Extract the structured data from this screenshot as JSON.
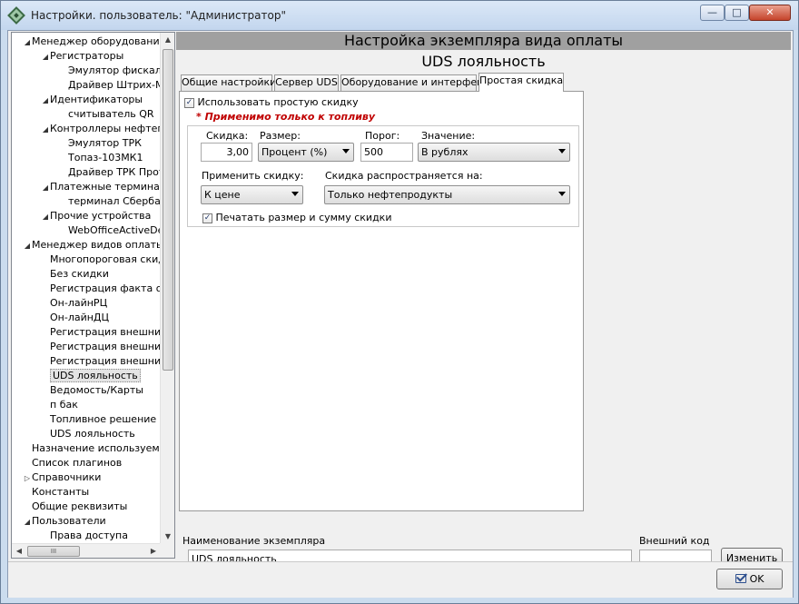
{
  "window": {
    "title": "Настройки. пользователь: \"Администратор\"",
    "min_icon": "minimize-icon",
    "max_icon": "maximize-icon",
    "close_icon": "close-icon"
  },
  "tree": {
    "items": [
      {
        "label": "Менеджер оборудования",
        "level": 0,
        "expander": "expanded"
      },
      {
        "label": "Регистраторы",
        "level": 1,
        "expander": "expanded"
      },
      {
        "label": "Эмулятор фискаль",
        "level": 2,
        "expander": "none"
      },
      {
        "label": "Драйвер Штрих-М",
        "level": 2,
        "expander": "none"
      },
      {
        "label": "Идентификаторы",
        "level": 1,
        "expander": "expanded"
      },
      {
        "label": "считыватель QR",
        "level": 2,
        "expander": "none"
      },
      {
        "label": "Контроллеры нефтепр",
        "level": 1,
        "expander": "expanded"
      },
      {
        "label": "Эмулятор ТРК",
        "level": 2,
        "expander": "none"
      },
      {
        "label": "Топаз-103МК1",
        "level": 2,
        "expander": "none"
      },
      {
        "label": "Драйвер ТРК Прот",
        "level": 2,
        "expander": "none"
      },
      {
        "label": "Платежные терминалы",
        "level": 1,
        "expander": "expanded"
      },
      {
        "label": "терминал Сбербан",
        "level": 2,
        "expander": "none"
      },
      {
        "label": "Прочие устройства",
        "level": 1,
        "expander": "expanded"
      },
      {
        "label": "WebOfficeActiveDe",
        "level": 2,
        "expander": "none"
      },
      {
        "label": "Менеджер видов оплаты",
        "level": 0,
        "expander": "expanded"
      },
      {
        "label": "Многопороговая скидк",
        "level": 1,
        "expander": "none"
      },
      {
        "label": "Без скидки",
        "level": 1,
        "expander": "none"
      },
      {
        "label": "Регистрация факта от",
        "level": 1,
        "expander": "none"
      },
      {
        "label": "Он-лайнРЦ",
        "level": 1,
        "expander": "none"
      },
      {
        "label": "Он-лайнДЦ",
        "level": 1,
        "expander": "none"
      },
      {
        "label": "Регистрация внешних",
        "level": 1,
        "expander": "none"
      },
      {
        "label": "Регистрация внешних",
        "level": 1,
        "expander": "none"
      },
      {
        "label": "Регистрация внешних",
        "level": 1,
        "expander": "none"
      },
      {
        "label": "UDS лояльность",
        "level": 1,
        "expander": "none",
        "selected": true
      },
      {
        "label": "Ведомость/Карты",
        "level": 1,
        "expander": "none"
      },
      {
        "label": "п бак",
        "level": 1,
        "expander": "none"
      },
      {
        "label": "Топливное решение ОI",
        "level": 1,
        "expander": "none"
      },
      {
        "label": "UDS лояльность",
        "level": 1,
        "expander": "none"
      },
      {
        "label": "Назначение используемых",
        "level": 0,
        "expander": "none"
      },
      {
        "label": "Список плагинов",
        "level": 0,
        "expander": "none"
      },
      {
        "label": "Справочники",
        "level": 0,
        "expander": "collapsed"
      },
      {
        "label": "Константы",
        "level": 0,
        "expander": "none"
      },
      {
        "label": "Общие реквизиты",
        "level": 0,
        "expander": "none"
      },
      {
        "label": "Пользователи",
        "level": 0,
        "expander": "expanded"
      },
      {
        "label": "Права доступа",
        "level": 1,
        "expander": "none"
      }
    ],
    "hscroll_grip": "III"
  },
  "main": {
    "header": "Настройка экземпляра вида оплаты",
    "subheader": "UDS лояльность",
    "tabs": [
      {
        "label": "Общие настройки",
        "active": false
      },
      {
        "label": "Сервер UDS",
        "active": false
      },
      {
        "label": "Оборудование и интерфейс",
        "active": false
      },
      {
        "label": "Простая скидка",
        "active": true
      }
    ],
    "panel": {
      "use_simple_discount_label": "Использовать простую скидку",
      "use_simple_discount_checked": true,
      "warning": "* Применимо только к топливу",
      "discount_label": "Скидка:",
      "discount_value": "3,00",
      "size_label": "Размер:",
      "size_value": "Процент (%)",
      "threshold_label": "Порог:",
      "threshold_value": "500",
      "value_label": "Значение:",
      "value_value": "В рублях",
      "apply_label": "Применить скидку:",
      "apply_value": "К цене",
      "scope_label": "Скидка распространяется на:",
      "scope_value": "Только нефтепродукты",
      "print_label": "Печатать размер и сумму скидки",
      "print_checked": true
    }
  },
  "bottom": {
    "instance_name_label": "Наименование экземпляра",
    "instance_name_value": "UDS лояльность",
    "ext_code_label": "Внешний код",
    "ext_code_value": "",
    "change_button": "Изменить"
  },
  "footer": {
    "ok_button": "OK"
  }
}
